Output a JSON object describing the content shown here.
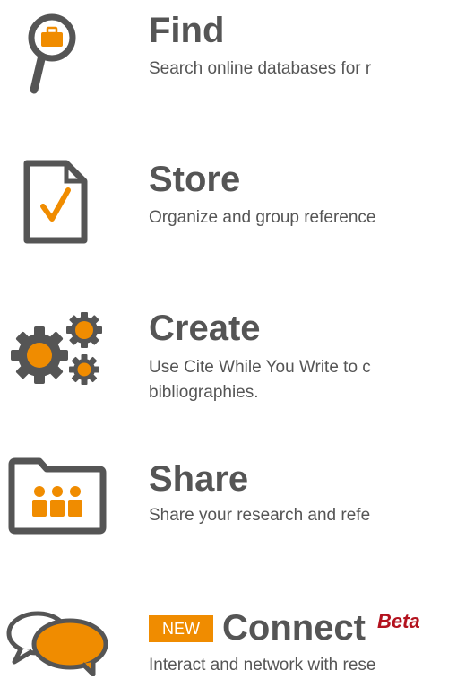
{
  "colors": {
    "accent": "#f08c00",
    "icon_gray": "#555555",
    "text": "#555555",
    "beta": "#b3121e"
  },
  "features": {
    "find": {
      "icon": "magnifier-briefcase-icon",
      "title": "Find",
      "description": "Search online databases for r"
    },
    "store": {
      "icon": "document-check-icon",
      "title": "Store",
      "description": "Organize and group reference"
    },
    "create": {
      "icon": "gears-icon",
      "title": "Create",
      "description_line1": "Use Cite While You Write to c",
      "description_line2": "bibliographies."
    },
    "share": {
      "icon": "folder-people-icon",
      "title": "Share",
      "description": "Share your research and refe"
    },
    "connect": {
      "icon": "chat-bubbles-icon",
      "badge": "NEW",
      "title": "Connect",
      "beta": "Beta",
      "description": "Interact and network with rese"
    }
  }
}
